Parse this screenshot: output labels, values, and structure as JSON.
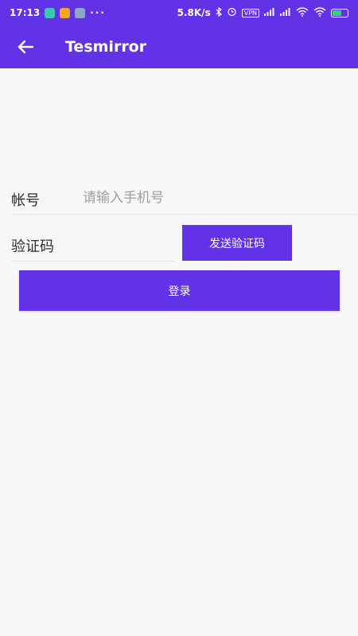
{
  "status_bar": {
    "time": "17:13",
    "dots": "···",
    "network_speed": "5.8K/s",
    "vpn_label": "VPN",
    "icons": [
      "app-notification-icon",
      "message-icon",
      "telegram-icon",
      "bluetooth-icon",
      "alarm-icon",
      "signal-icon",
      "wifi-icon",
      "battery-icon"
    ],
    "battery_level": 0.55
  },
  "app_bar": {
    "title": "Tesmirror",
    "back_icon": "arrow-left-icon"
  },
  "form": {
    "account_label": "帐号",
    "account_placeholder": "请输入手机号",
    "account_value": "",
    "code_label": "验证码",
    "code_value": "",
    "send_code_label": "发送验证码",
    "login_label": "登录"
  },
  "colors": {
    "primary": "#6233e6",
    "background": "#f7f7f7",
    "battery_fill": "#35d47a"
  }
}
